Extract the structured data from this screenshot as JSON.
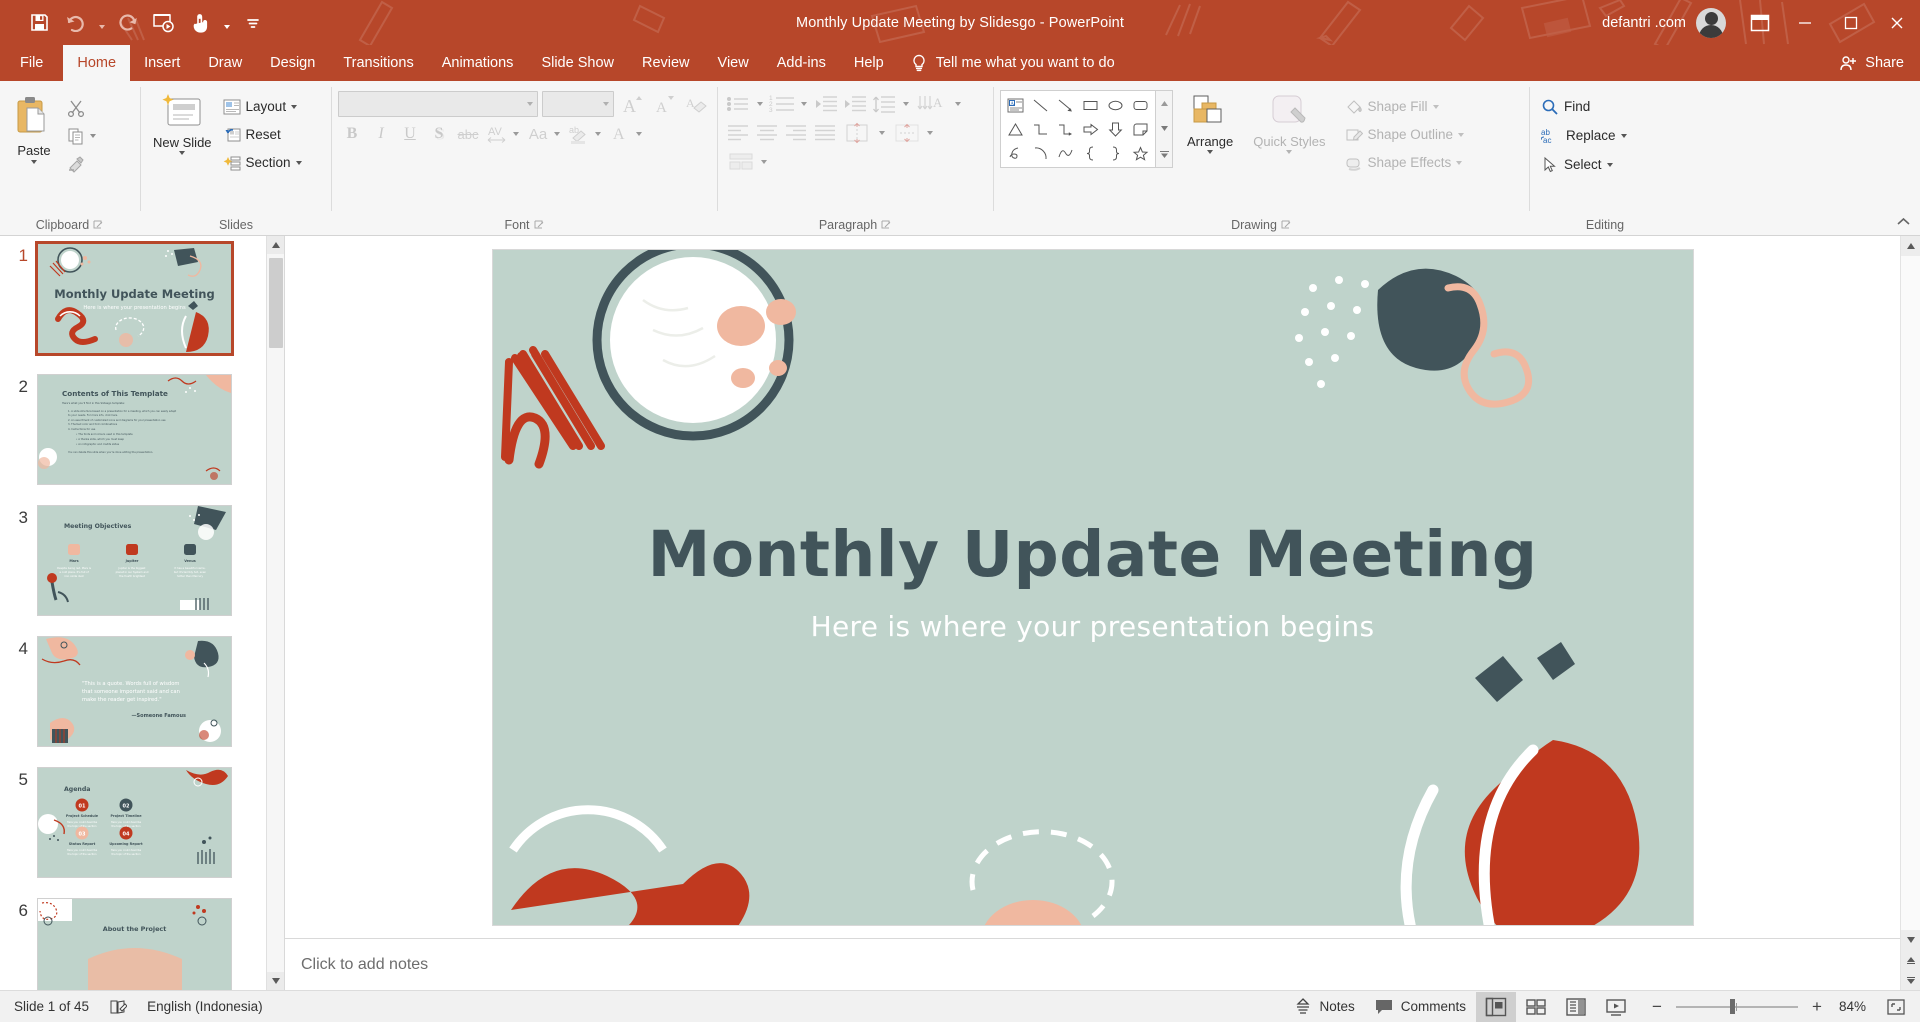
{
  "app": {
    "title": "Monthly Update Meeting by Slidesgo  -  PowerPoint",
    "user": "defantri .com",
    "accent": "#b7472a",
    "slide_bg": "#bfd3cb",
    "title_color": "#41545a"
  },
  "quick_access": {
    "items": [
      {
        "name": "save-icon",
        "label": "Save"
      },
      {
        "name": "undo-icon",
        "label": "Undo"
      },
      {
        "name": "redo-icon",
        "label": "Redo"
      },
      {
        "name": "start-slideshow-icon",
        "label": "Start From Beginning"
      },
      {
        "name": "touch-mode-icon",
        "label": "Touch/Mouse Mode"
      },
      {
        "name": "customize-qat-icon",
        "label": "Customize Quick Access Toolbar"
      }
    ]
  },
  "window_controls": {
    "ribbon_display": "Ribbon Display Options",
    "minimize": "Minimize",
    "restore": "Restore Down",
    "close": "Close"
  },
  "tabs": [
    {
      "label": "File",
      "active": false
    },
    {
      "label": "Home",
      "active": true
    },
    {
      "label": "Insert",
      "active": false
    },
    {
      "label": "Draw",
      "active": false
    },
    {
      "label": "Design",
      "active": false
    },
    {
      "label": "Transitions",
      "active": false
    },
    {
      "label": "Animations",
      "active": false
    },
    {
      "label": "Slide Show",
      "active": false
    },
    {
      "label": "Review",
      "active": false
    },
    {
      "label": "View",
      "active": false
    },
    {
      "label": "Add-ins",
      "active": false
    },
    {
      "label": "Help",
      "active": false
    }
  ],
  "tell_me": "Tell me what you want to do",
  "share": "Share",
  "ribbon": {
    "clipboard": {
      "group_label": "Clipboard",
      "paste": "Paste",
      "cut": "Cut",
      "copy": "Copy",
      "format_painter": "Format Painter"
    },
    "slides": {
      "group_label": "Slides",
      "new_slide": "New Slide",
      "layout": "Layout",
      "reset": "Reset",
      "section": "Section"
    },
    "font": {
      "group_label": "Font",
      "font_name": "",
      "font_size": "",
      "font_name_placeholder": "",
      "font_size_placeholder": "",
      "bold": "B",
      "italic": "I",
      "underline": "U",
      "shadow": "S",
      "strikethrough": "abc",
      "character_spacing": "AV",
      "change_case": "Aa",
      "increase_font": "A",
      "decrease_font": "A",
      "clear_formatting": "Clear All Formatting",
      "text_highlight": "Text Highlight Color",
      "font_color": "A"
    },
    "paragraph": {
      "group_label": "Paragraph",
      "bullets": "Bullets",
      "numbering": "Numbering",
      "decrease_indent": "Decrease List Level",
      "increase_indent": "Increase List Level",
      "line_spacing": "Line Spacing",
      "text_direction": "Text Direction",
      "align_text": "Align Text",
      "convert_smartart": "Convert to SmartArt",
      "align_left": "Align Left",
      "center": "Center",
      "align_right": "Align Right",
      "justify": "Justify",
      "columns": "Columns"
    },
    "drawing": {
      "group_label": "Drawing",
      "arrange": "Arrange",
      "quick_styles": "Quick Styles",
      "shape_fill": "Shape Fill",
      "shape_outline": "Shape Outline",
      "shape_effects": "Shape Effects",
      "shapes": [
        "text-box-shape",
        "line-shape",
        "arrow-shape",
        "rectangle-shape",
        "oval-shape",
        "rounded-rectangle-shape",
        "triangle-shape",
        "elbow-connector-shape",
        "elbow-arrow-connector-shape",
        "right-arrow-shape",
        "down-arrow-shape",
        "folded-corner-shape",
        "scribble-shape",
        "arc-shape",
        "curve-shape",
        "left-brace-shape",
        "right-brace-shape",
        "star-shape"
      ]
    },
    "editing": {
      "group_label": "Editing",
      "find": "Find",
      "replace": "Replace",
      "select": "Select"
    }
  },
  "slides_panel": {
    "slides": [
      {
        "num": "1",
        "title": "Monthly Update Meeting",
        "subtitle": "Here is where your presentation begins",
        "kind": "title",
        "selected": true
      },
      {
        "num": "2",
        "title": "Contents of This Template",
        "kind": "contents",
        "selected": false
      },
      {
        "num": "3",
        "title": "Meeting Objectives",
        "kind": "objectives",
        "selected": false
      },
      {
        "num": "4",
        "title": "“This is a quote. Words full of wisdom that someone important said and can make the reader get inspired.”",
        "attribution": "—Someone Famous",
        "kind": "quote",
        "selected": false
      },
      {
        "num": "5",
        "title": "Agenda",
        "kind": "agenda",
        "selected": false
      },
      {
        "num": "6",
        "title": "About the Project",
        "kind": "about",
        "selected": false
      }
    ],
    "objectives_items": [
      {
        "name": "Mars",
        "desc": "Despite being red, Mars is a cold place. It's full of iron oxide dust"
      },
      {
        "name": "Jupiter",
        "desc": "Jupiter is the biggest planet in our Solar System and the fourth brightest"
      },
      {
        "name": "Venus",
        "desc": "It has a beautiful name, but it's terribly hot, even hotter than Mercury"
      }
    ],
    "agenda_items": [
      {
        "num": "01",
        "name": "Project Schedule",
        "desc": "Here you could describe the topic of the section"
      },
      {
        "num": "02",
        "name": "Project Timeline",
        "desc": "Here you could describe the topic of the section"
      },
      {
        "num": "03",
        "name": "Status Report",
        "desc": "Here you could describe the topic of the section"
      },
      {
        "num": "04",
        "name": "Upcoming Report",
        "desc": "Here you could describe the topic of the section"
      }
    ]
  },
  "slide": {
    "title": "Monthly Update Meeting",
    "subtitle": "Here is where your presentation begins"
  },
  "notes": {
    "placeholder": "Click to add notes"
  },
  "status_bar": {
    "slide_count": "Slide 1 of 45",
    "accessibility": "Accessibility Checker",
    "language": "English (Indonesia)",
    "notes": "Notes",
    "comments": "Comments",
    "views": [
      {
        "name": "normal-view-button",
        "label": "Normal",
        "active": true
      },
      {
        "name": "slide-sorter-view-button",
        "label": "Slide Sorter",
        "active": false
      },
      {
        "name": "reading-view-button",
        "label": "Reading View",
        "active": false
      },
      {
        "name": "slide-show-button",
        "label": "Slide Show",
        "active": false
      }
    ],
    "zoom_out": "−",
    "zoom_in": "+",
    "zoom_level": "84%",
    "fit_to_window": "Fit slide to current window"
  }
}
